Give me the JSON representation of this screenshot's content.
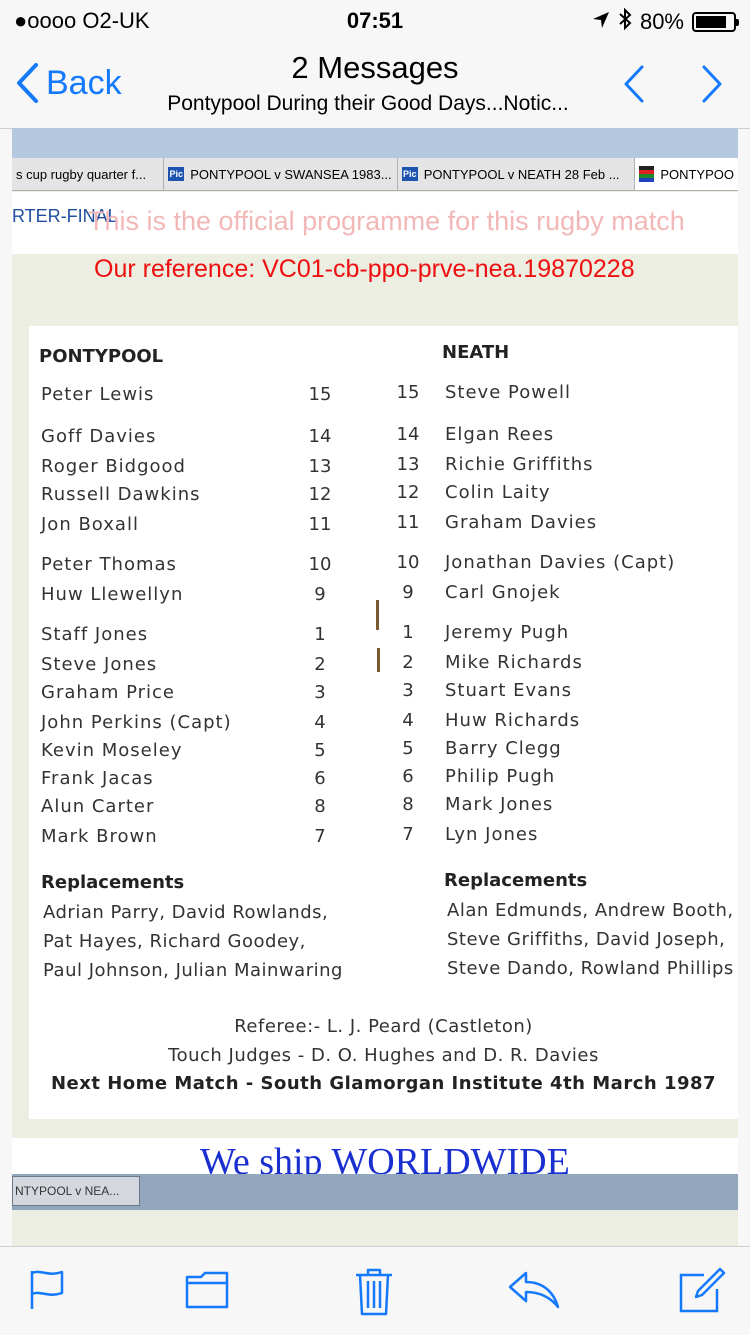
{
  "status": {
    "carrier": "●oooo O2-UK",
    "time": "07:51",
    "battery": "80%",
    "battery_level": 0.8
  },
  "nav": {
    "back": "Back",
    "title": "2 Messages",
    "subtitle": "Pontypool During their Good Days...Notic..."
  },
  "browser": {
    "tabs": [
      {
        "label": "s cup rugby quarter f...",
        "icon": ""
      },
      {
        "label": "PONTYPOOL v SWANSEA 1983...",
        "icon": "Pic"
      },
      {
        "label": "PONTYPOOL v NEATH 28 Feb ...",
        "icon": "Pic"
      },
      {
        "label": "PONTYPOO",
        "icon": ""
      }
    ],
    "section_label": "RTER-FINAL",
    "watermark": "This is the official programme for this rugby match",
    "reference": "Our reference: VC01-cb-ppo-prve-nea.19870228",
    "banner": "We ship WORLDWIDE",
    "taskbar_item": "NTYPOOL v NEA..."
  },
  "programme": {
    "home_team": "PONTYPOOL",
    "away_team": "NEATH",
    "home": [
      {
        "no": "15",
        "name": "Peter Lewis"
      },
      {
        "no": "14",
        "name": "Goff Davies"
      },
      {
        "no": "13",
        "name": "Roger Bidgood"
      },
      {
        "no": "12",
        "name": "Russell Dawkins"
      },
      {
        "no": "11",
        "name": "Jon Boxall"
      },
      {
        "no": "10",
        "name": "Peter Thomas"
      },
      {
        "no": "9",
        "name": "Huw Llewellyn"
      },
      {
        "no": "1",
        "name": "Staff Jones"
      },
      {
        "no": "2",
        "name": "Steve Jones"
      },
      {
        "no": "3",
        "name": "Graham Price"
      },
      {
        "no": "4",
        "name": "John Perkins (Capt)"
      },
      {
        "no": "5",
        "name": "Kevin Moseley"
      },
      {
        "no": "6",
        "name": "Frank Jacas"
      },
      {
        "no": "8",
        "name": "Alun Carter"
      },
      {
        "no": "7",
        "name": "Mark Brown"
      }
    ],
    "away": [
      {
        "no": "15",
        "name": "Steve Powell"
      },
      {
        "no": "14",
        "name": "Elgan Rees"
      },
      {
        "no": "13",
        "name": "Richie Griffiths"
      },
      {
        "no": "12",
        "name": "Colin Laity"
      },
      {
        "no": "11",
        "name": "Graham Davies"
      },
      {
        "no": "10",
        "name": "Jonathan Davies (Capt)"
      },
      {
        "no": "9",
        "name": "Carl Gnojek"
      },
      {
        "no": "1",
        "name": "Jeremy Pugh"
      },
      {
        "no": "2",
        "name": "Mike Richards"
      },
      {
        "no": "3",
        "name": "Stuart Evans"
      },
      {
        "no": "4",
        "name": "Huw Richards"
      },
      {
        "no": "5",
        "name": "Barry Clegg"
      },
      {
        "no": "6",
        "name": "Philip Pugh"
      },
      {
        "no": "8",
        "name": "Mark Jones"
      },
      {
        "no": "7",
        "name": "Lyn Jones"
      }
    ],
    "replacements_label": "Replacements",
    "home_replacements": [
      "Adrian Parry, David Rowlands,",
      "Pat Hayes, Richard Goodey,",
      "Paul Johnson, Julian Mainwaring"
    ],
    "away_replacements": [
      "Alan Edmunds, Andrew Booth,",
      "Steve Griffiths, David Joseph,",
      "Steve Dando, Rowland Phillips"
    ],
    "referee": "Referee:- L. J. Peard (Castleton)",
    "touch_judges": "Touch Judges - D. O. Hughes and D. R. Davies",
    "next_match": "Next Home Match - South Glamorgan Institute 4th March 1987"
  },
  "toolbar": {
    "icons": [
      "flag-icon",
      "folder-icon",
      "trash-icon",
      "reply-icon",
      "compose-icon"
    ]
  },
  "colors": {
    "accent": "#1479fb",
    "reference": "#ee1010",
    "banner": "#1a2fd0"
  }
}
